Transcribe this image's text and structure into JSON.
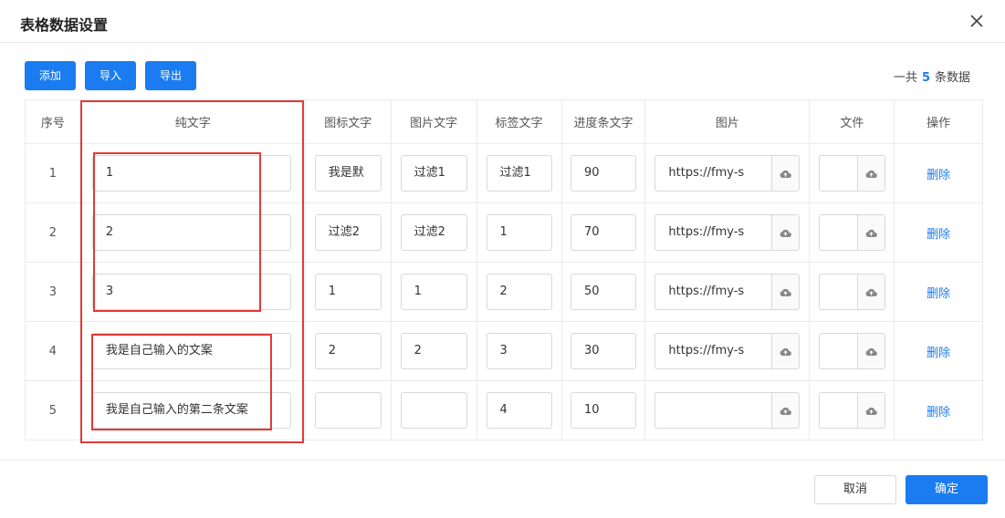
{
  "dialog": {
    "title": "表格数据设置",
    "close_icon": "close-icon"
  },
  "toolbar": {
    "add_label": "添加",
    "import_label": "导入",
    "export_label": "导出",
    "count_prefix": "一共",
    "count_value": "5",
    "count_suffix": "条数据"
  },
  "table": {
    "headers": [
      "序号",
      "纯文字",
      "图标文字",
      "图片文字",
      "标签文字",
      "进度条文字",
      "图片",
      "文件",
      "操作"
    ],
    "rows": [
      {
        "index": "1",
        "text": "1",
        "icon_text": "我是默",
        "image_text": "过滤1",
        "tag_text": "过滤1",
        "progress_text": "90",
        "image_url": "https://fmy-s",
        "file": "",
        "action": "删除"
      },
      {
        "index": "2",
        "text": "2",
        "icon_text": "过滤2",
        "image_text": "过滤2",
        "tag_text": "1",
        "progress_text": "70",
        "image_url": "https://fmy-s",
        "file": "",
        "action": "删除"
      },
      {
        "index": "3",
        "text": "3",
        "icon_text": "1",
        "image_text": "1",
        "tag_text": "2",
        "progress_text": "50",
        "image_url": "https://fmy-s",
        "file": "",
        "action": "删除"
      },
      {
        "index": "4",
        "text": "我是自己输入的文案",
        "icon_text": "2",
        "image_text": "2",
        "tag_text": "3",
        "progress_text": "30",
        "image_url": "https://fmy-s",
        "file": "",
        "action": "删除"
      },
      {
        "index": "5",
        "text": "我是自己输入的第二条文案",
        "icon_text": "",
        "image_text": "",
        "tag_text": "4",
        "progress_text": "10",
        "image_url": "",
        "file": "",
        "action": "删除"
      }
    ]
  },
  "footer": {
    "cancel_label": "取消",
    "confirm_label": "确定"
  },
  "colors": {
    "primary": "#1a7cf0",
    "highlight_border": "#e53935"
  },
  "icons": {
    "upload": "cloud-upload-icon"
  }
}
